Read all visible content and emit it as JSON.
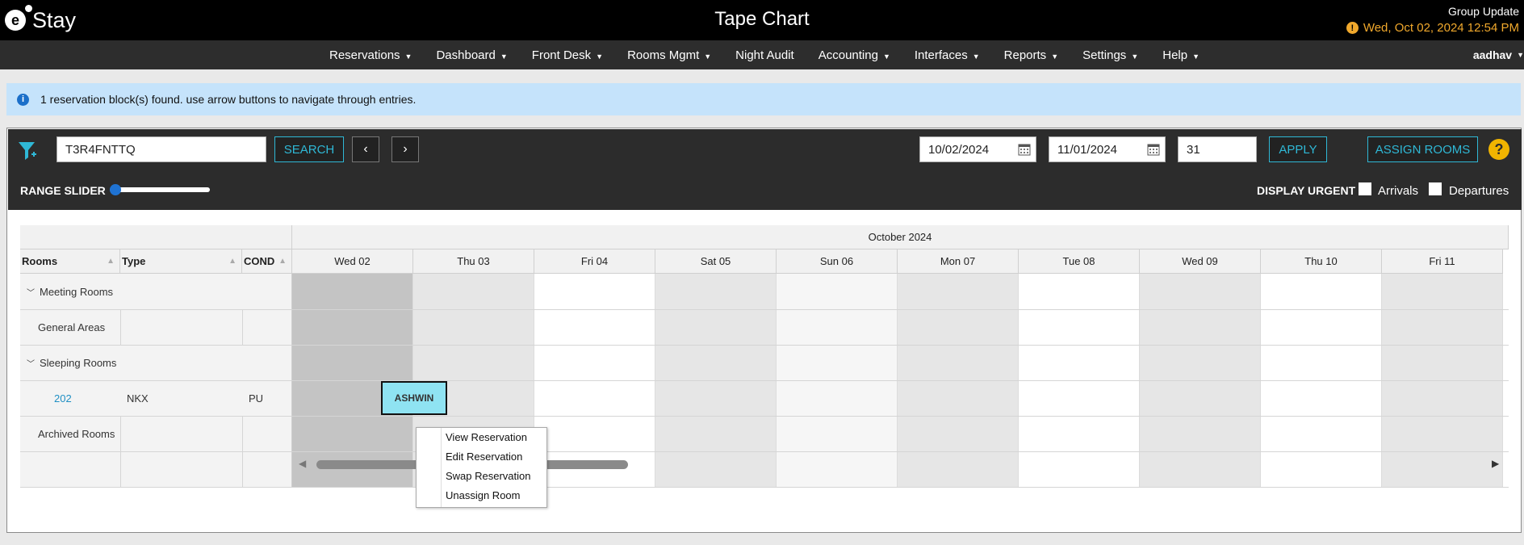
{
  "app": {
    "logo_letter": "e",
    "logo_text": "Stay"
  },
  "header": {
    "title": "Tape Chart",
    "group_update": "Group Update",
    "datetime": "Wed, Oct 02, 2024 12:54 PM"
  },
  "nav": {
    "items": [
      {
        "label": "Reservations",
        "has_menu": true
      },
      {
        "label": "Dashboard",
        "has_menu": true
      },
      {
        "label": "Front Desk",
        "has_menu": true
      },
      {
        "label": "Rooms Mgmt",
        "has_menu": true
      },
      {
        "label": "Night Audit",
        "has_menu": false
      },
      {
        "label": "Accounting",
        "has_menu": true
      },
      {
        "label": "Interfaces",
        "has_menu": true
      },
      {
        "label": "Reports",
        "has_menu": true
      },
      {
        "label": "Settings",
        "has_menu": true
      },
      {
        "label": "Help",
        "has_menu": true
      }
    ],
    "user": "aadhav"
  },
  "info": {
    "message": "1 reservation block(s) found. use arrow buttons to navigate through entries."
  },
  "toolbar": {
    "search_value": "T3R4FNTTQ",
    "search_label": "SEARCH",
    "start_date": "10/02/2024",
    "end_date": "11/01/2024",
    "days": "31",
    "apply_label": "APPLY",
    "assign_label": "ASSIGN ROOMS",
    "range_slider_label": "RANGE SLIDER",
    "display_urgent_label": "DISPLAY URGENT",
    "arrivals_label": "Arrivals",
    "departures_label": "Departures",
    "range_slider_value": 0
  },
  "grid": {
    "month": "October 2024",
    "columns": {
      "rooms": "Rooms",
      "type": "Type",
      "cond": "COND"
    },
    "days": [
      "Wed 02",
      "Thu 03",
      "Fri 04",
      "Sat 05",
      "Sun 06",
      "Mon 07",
      "Tue 08",
      "Wed 09",
      "Thu 10",
      "Fri 11"
    ],
    "rows": [
      {
        "label": "Meeting Rooms",
        "group": true
      },
      {
        "label": "General Areas",
        "group": false
      },
      {
        "label": "Sleeping Rooms",
        "group": true
      },
      {
        "label": "202",
        "type": "NKX",
        "cond": "PU",
        "room": true
      },
      {
        "label": "Archived Rooms",
        "group": false
      }
    ],
    "reservation": "ASHWIN"
  },
  "context_menu": {
    "items": [
      "View Reservation",
      "Edit Reservation",
      "Swap Reservation",
      "Unassign Room"
    ]
  },
  "colors": {
    "accent": "#2fb8d6",
    "warning": "#f0a82c",
    "reservation_bg": "#8fe3f2",
    "info_bg": "#c5e3fb"
  }
}
